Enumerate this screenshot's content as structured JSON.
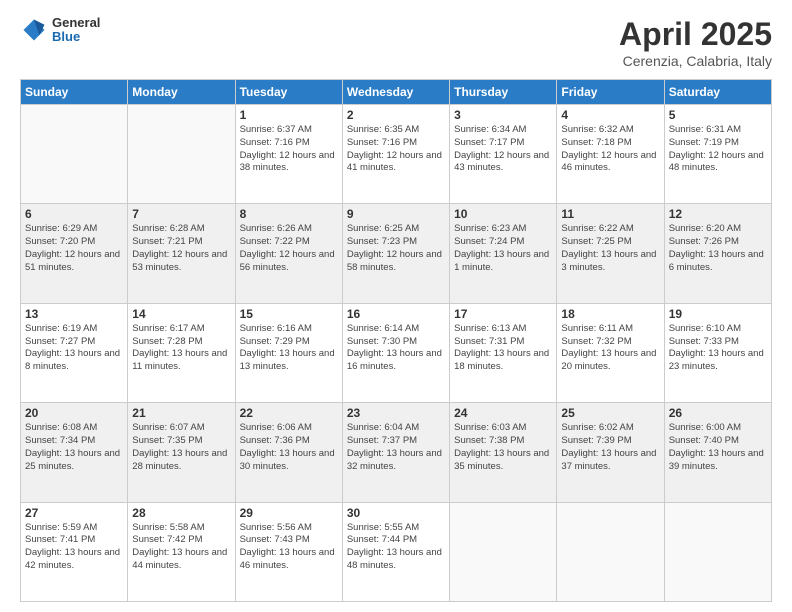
{
  "header": {
    "logo": {
      "general": "General",
      "blue": "Blue"
    },
    "title": "April 2025",
    "subtitle": "Cerenzia, Calabria, Italy"
  },
  "days_of_week": [
    "Sunday",
    "Monday",
    "Tuesday",
    "Wednesday",
    "Thursday",
    "Friday",
    "Saturday"
  ],
  "weeks": [
    [
      {
        "day": "",
        "sunrise": "",
        "sunset": "",
        "daylight": ""
      },
      {
        "day": "",
        "sunrise": "",
        "sunset": "",
        "daylight": ""
      },
      {
        "day": "1",
        "sunrise": "Sunrise: 6:37 AM",
        "sunset": "Sunset: 7:16 PM",
        "daylight": "Daylight: 12 hours and 38 minutes."
      },
      {
        "day": "2",
        "sunrise": "Sunrise: 6:35 AM",
        "sunset": "Sunset: 7:16 PM",
        "daylight": "Daylight: 12 hours and 41 minutes."
      },
      {
        "day": "3",
        "sunrise": "Sunrise: 6:34 AM",
        "sunset": "Sunset: 7:17 PM",
        "daylight": "Daylight: 12 hours and 43 minutes."
      },
      {
        "day": "4",
        "sunrise": "Sunrise: 6:32 AM",
        "sunset": "Sunset: 7:18 PM",
        "daylight": "Daylight: 12 hours and 46 minutes."
      },
      {
        "day": "5",
        "sunrise": "Sunrise: 6:31 AM",
        "sunset": "Sunset: 7:19 PM",
        "daylight": "Daylight: 12 hours and 48 minutes."
      }
    ],
    [
      {
        "day": "6",
        "sunrise": "Sunrise: 6:29 AM",
        "sunset": "Sunset: 7:20 PM",
        "daylight": "Daylight: 12 hours and 51 minutes."
      },
      {
        "day": "7",
        "sunrise": "Sunrise: 6:28 AM",
        "sunset": "Sunset: 7:21 PM",
        "daylight": "Daylight: 12 hours and 53 minutes."
      },
      {
        "day": "8",
        "sunrise": "Sunrise: 6:26 AM",
        "sunset": "Sunset: 7:22 PM",
        "daylight": "Daylight: 12 hours and 56 minutes."
      },
      {
        "day": "9",
        "sunrise": "Sunrise: 6:25 AM",
        "sunset": "Sunset: 7:23 PM",
        "daylight": "Daylight: 12 hours and 58 minutes."
      },
      {
        "day": "10",
        "sunrise": "Sunrise: 6:23 AM",
        "sunset": "Sunset: 7:24 PM",
        "daylight": "Daylight: 13 hours and 1 minute."
      },
      {
        "day": "11",
        "sunrise": "Sunrise: 6:22 AM",
        "sunset": "Sunset: 7:25 PM",
        "daylight": "Daylight: 13 hours and 3 minutes."
      },
      {
        "day": "12",
        "sunrise": "Sunrise: 6:20 AM",
        "sunset": "Sunset: 7:26 PM",
        "daylight": "Daylight: 13 hours and 6 minutes."
      }
    ],
    [
      {
        "day": "13",
        "sunrise": "Sunrise: 6:19 AM",
        "sunset": "Sunset: 7:27 PM",
        "daylight": "Daylight: 13 hours and 8 minutes."
      },
      {
        "day": "14",
        "sunrise": "Sunrise: 6:17 AM",
        "sunset": "Sunset: 7:28 PM",
        "daylight": "Daylight: 13 hours and 11 minutes."
      },
      {
        "day": "15",
        "sunrise": "Sunrise: 6:16 AM",
        "sunset": "Sunset: 7:29 PM",
        "daylight": "Daylight: 13 hours and 13 minutes."
      },
      {
        "day": "16",
        "sunrise": "Sunrise: 6:14 AM",
        "sunset": "Sunset: 7:30 PM",
        "daylight": "Daylight: 13 hours and 16 minutes."
      },
      {
        "day": "17",
        "sunrise": "Sunrise: 6:13 AM",
        "sunset": "Sunset: 7:31 PM",
        "daylight": "Daylight: 13 hours and 18 minutes."
      },
      {
        "day": "18",
        "sunrise": "Sunrise: 6:11 AM",
        "sunset": "Sunset: 7:32 PM",
        "daylight": "Daylight: 13 hours and 20 minutes."
      },
      {
        "day": "19",
        "sunrise": "Sunrise: 6:10 AM",
        "sunset": "Sunset: 7:33 PM",
        "daylight": "Daylight: 13 hours and 23 minutes."
      }
    ],
    [
      {
        "day": "20",
        "sunrise": "Sunrise: 6:08 AM",
        "sunset": "Sunset: 7:34 PM",
        "daylight": "Daylight: 13 hours and 25 minutes."
      },
      {
        "day": "21",
        "sunrise": "Sunrise: 6:07 AM",
        "sunset": "Sunset: 7:35 PM",
        "daylight": "Daylight: 13 hours and 28 minutes."
      },
      {
        "day": "22",
        "sunrise": "Sunrise: 6:06 AM",
        "sunset": "Sunset: 7:36 PM",
        "daylight": "Daylight: 13 hours and 30 minutes."
      },
      {
        "day": "23",
        "sunrise": "Sunrise: 6:04 AM",
        "sunset": "Sunset: 7:37 PM",
        "daylight": "Daylight: 13 hours and 32 minutes."
      },
      {
        "day": "24",
        "sunrise": "Sunrise: 6:03 AM",
        "sunset": "Sunset: 7:38 PM",
        "daylight": "Daylight: 13 hours and 35 minutes."
      },
      {
        "day": "25",
        "sunrise": "Sunrise: 6:02 AM",
        "sunset": "Sunset: 7:39 PM",
        "daylight": "Daylight: 13 hours and 37 minutes."
      },
      {
        "day": "26",
        "sunrise": "Sunrise: 6:00 AM",
        "sunset": "Sunset: 7:40 PM",
        "daylight": "Daylight: 13 hours and 39 minutes."
      }
    ],
    [
      {
        "day": "27",
        "sunrise": "Sunrise: 5:59 AM",
        "sunset": "Sunset: 7:41 PM",
        "daylight": "Daylight: 13 hours and 42 minutes."
      },
      {
        "day": "28",
        "sunrise": "Sunrise: 5:58 AM",
        "sunset": "Sunset: 7:42 PM",
        "daylight": "Daylight: 13 hours and 44 minutes."
      },
      {
        "day": "29",
        "sunrise": "Sunrise: 5:56 AM",
        "sunset": "Sunset: 7:43 PM",
        "daylight": "Daylight: 13 hours and 46 minutes."
      },
      {
        "day": "30",
        "sunrise": "Sunrise: 5:55 AM",
        "sunset": "Sunset: 7:44 PM",
        "daylight": "Daylight: 13 hours and 48 minutes."
      },
      {
        "day": "",
        "sunrise": "",
        "sunset": "",
        "daylight": ""
      },
      {
        "day": "",
        "sunrise": "",
        "sunset": "",
        "daylight": ""
      },
      {
        "day": "",
        "sunrise": "",
        "sunset": "",
        "daylight": ""
      }
    ]
  ]
}
